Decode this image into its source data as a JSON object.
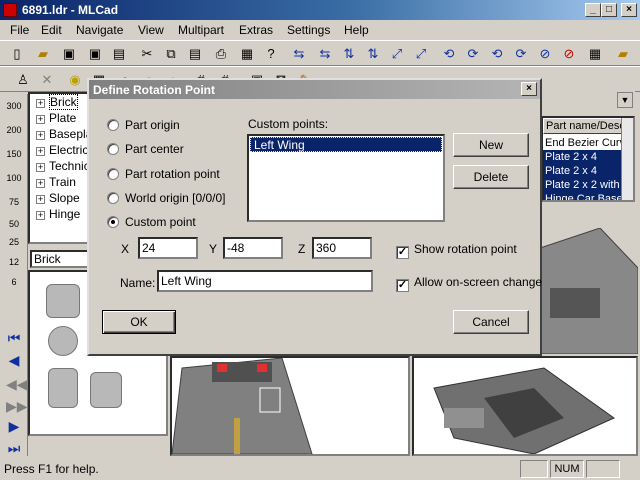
{
  "window": {
    "title": "6891.ldr - MLCad",
    "minimize": "_",
    "maximize": "□",
    "close": "×"
  },
  "menu": [
    "File",
    "Edit",
    "Navigate",
    "View",
    "Multipart",
    "Extras",
    "Settings",
    "Help"
  ],
  "left_toolbar": {
    "zoom_levels": [
      "300",
      "200",
      "150",
      "100",
      "75",
      "50",
      "25",
      "12",
      "6"
    ]
  },
  "tree": {
    "items": [
      "Brick",
      "Plate",
      "Baseplate",
      "Electric",
      "Technic",
      "Train",
      "Slope",
      "Hinge"
    ]
  },
  "brick_combo": "Brick",
  "parts_list": {
    "header": "Part name/Description",
    "rows": [
      {
        "text": "End Bezier Curve",
        "selected": false
      },
      {
        "text": "Plate  2 x  4",
        "selected": true
      },
      {
        "text": "Plate  2 x  4",
        "selected": true
      },
      {
        "text": "Plate  2 x  2 with",
        "selected": true
      },
      {
        "text": "Hinge Car Base",
        "selected": true
      }
    ]
  },
  "dialog": {
    "title": "Define Rotation Point",
    "close": "×",
    "options": [
      {
        "label": "Part origin",
        "selected": false
      },
      {
        "label": "Part center",
        "selected": false
      },
      {
        "label": "Part rotation point",
        "selected": false
      },
      {
        "label": "World origin [0/0/0]",
        "selected": false
      },
      {
        "label": "Custom point",
        "selected": true
      }
    ],
    "custom_points_label": "Custom points:",
    "custom_points": [
      "Left Wing"
    ],
    "new_button": "New",
    "delete_button": "Delete",
    "x_label": "X",
    "x_value": "24",
    "y_label": "Y",
    "y_value": "-48",
    "z_label": "Z",
    "z_value": "360",
    "name_label": "Name:",
    "name_value": "Left Wing",
    "show_rotation_point": "Show rotation point",
    "allow_onscreen_change": "Allow on-screen change",
    "ok_button": "OK",
    "cancel_button": "Cancel"
  },
  "status": {
    "text": "Press F1 for help.",
    "num": "NUM"
  },
  "colors": {
    "title_active": "#0a246a",
    "selection": "#0a246a",
    "face": "#d4d0c8"
  }
}
